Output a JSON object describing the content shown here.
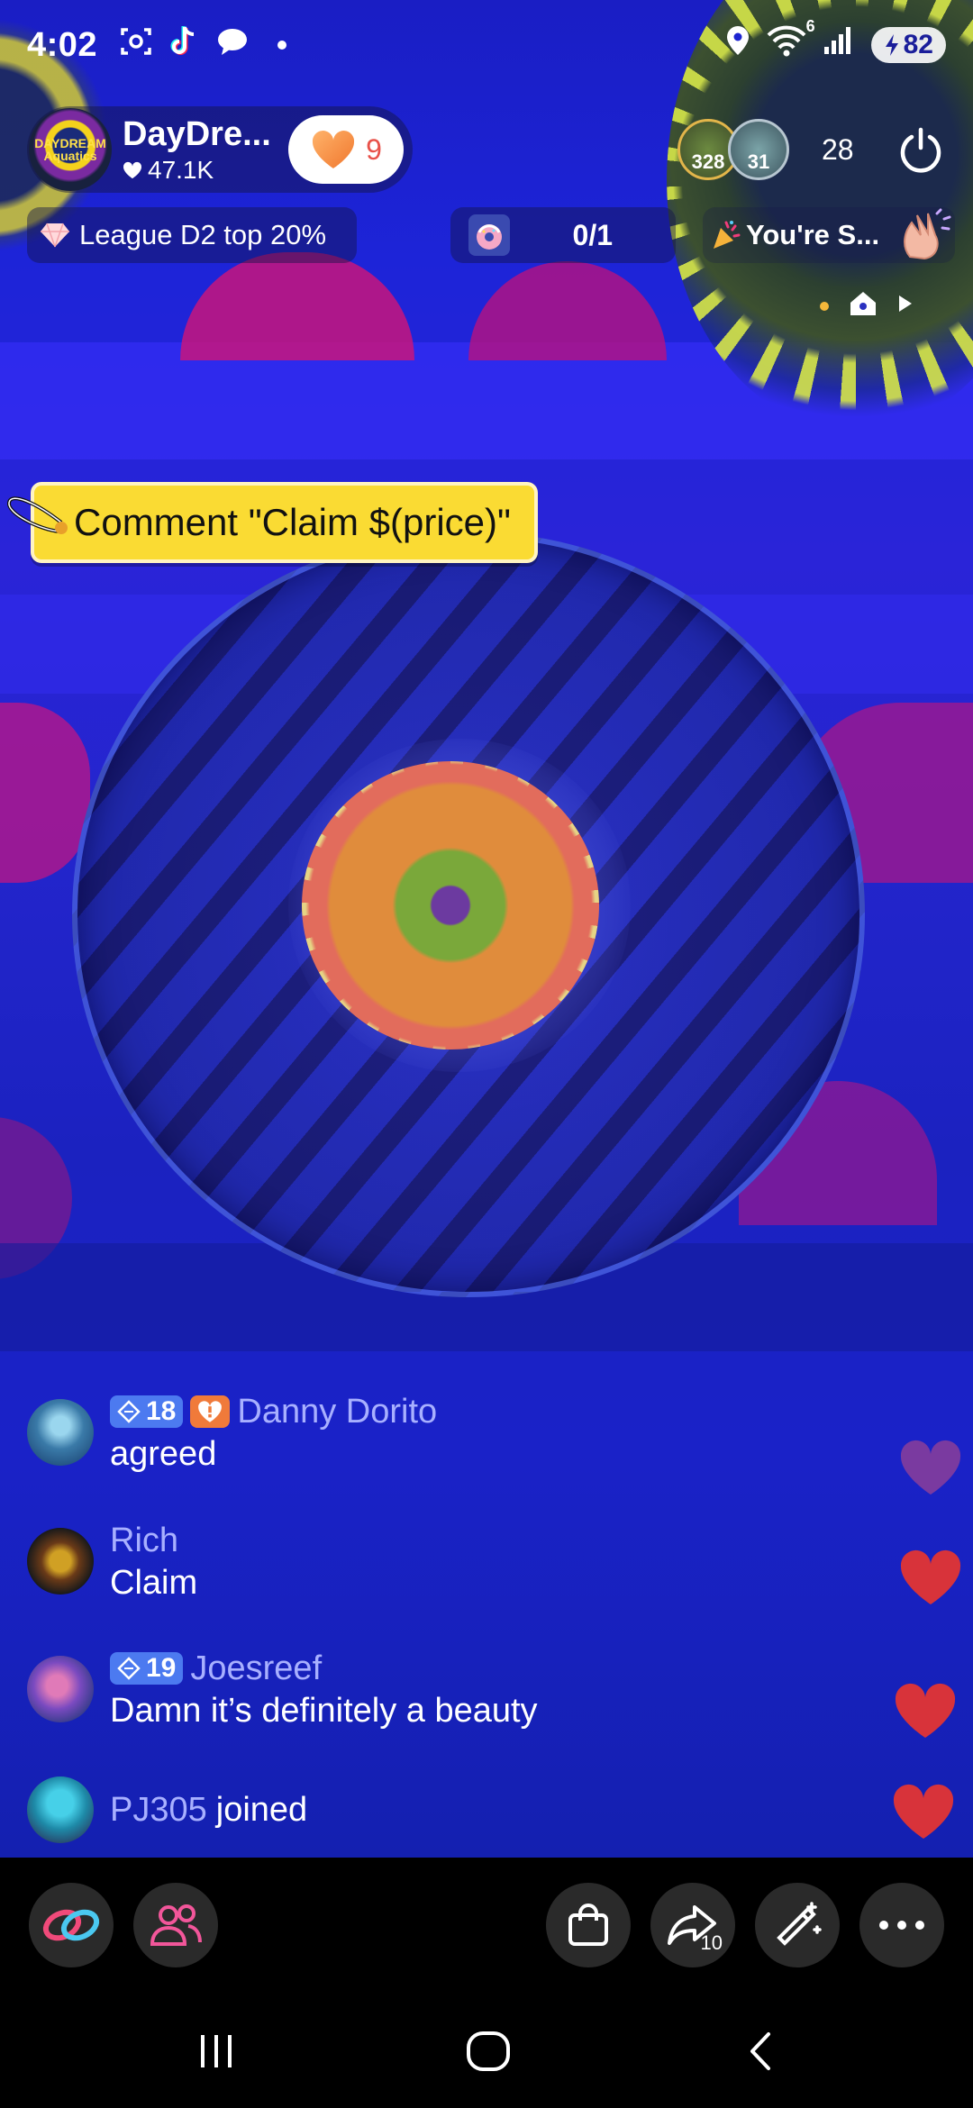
{
  "status_bar": {
    "time": "4:02",
    "battery": "82",
    "network_label": "6",
    "icons": [
      "screenshot-icon",
      "tiktok-icon",
      "chat-bubble-icon",
      "location-icon",
      "wifi-icon",
      "signal-icon",
      "battery-icon"
    ]
  },
  "host": {
    "avatar_text": "DAYDREAM Aquatics",
    "name": "DayDre...",
    "likes": "47.1K",
    "follow_count": "9"
  },
  "viewers": {
    "avatar_1_badge": "328",
    "avatar_2_badge": "31",
    "count": "28"
  },
  "chips": {
    "league": "League D2 top 20%",
    "goal": "0/1",
    "greeting": "You're S..."
  },
  "claim_tag": {
    "text": "Comment \"Claim $(price)\""
  },
  "comments": [
    {
      "level": "18",
      "name": "Danny Dorito",
      "text": "agreed",
      "has_sub_badge": true
    },
    {
      "level": "",
      "name": "Rich",
      "text": "Claim",
      "has_sub_badge": false
    },
    {
      "level": "19",
      "name": "Joesreef",
      "text": "Damn it’s definitely a beauty",
      "has_sub_badge": false
    }
  ],
  "joined": {
    "name": "PJ305",
    "text": "joined"
  },
  "bottom_bar": {
    "share_count": "10"
  },
  "colors": {
    "accent_yellow": "#fadb33",
    "heart_red": "#d8333a",
    "level_badge": "#4c7af0",
    "name_color": "#a8b0ff"
  }
}
